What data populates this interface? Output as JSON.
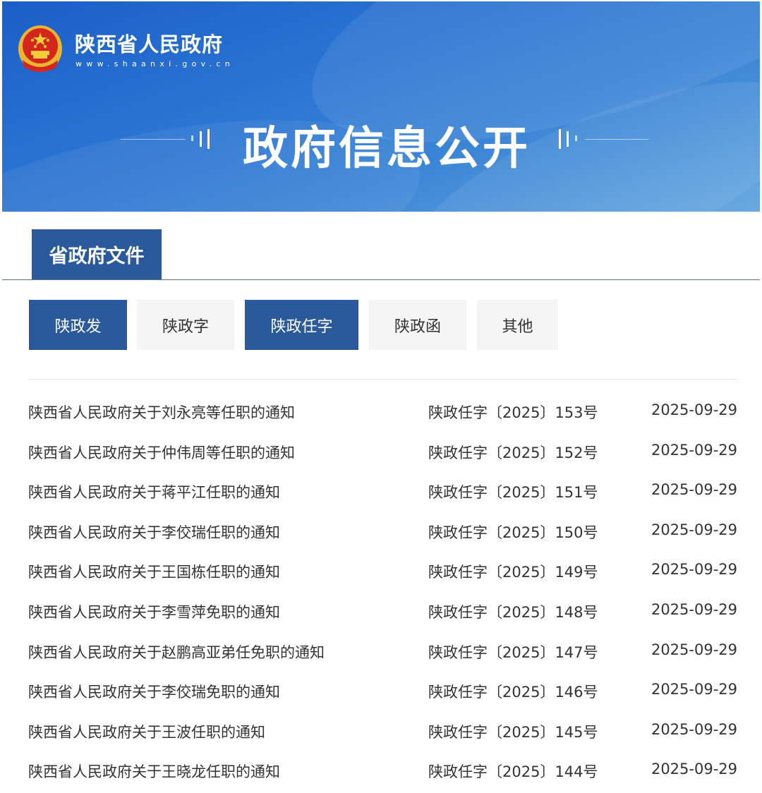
{
  "header": {
    "site_name": "陕西省人民政府",
    "site_url": "www.shaanxi.gov.cn",
    "banner_title": "政府信息公开",
    "emblem_icon": "national-emblem-icon"
  },
  "section": {
    "tab_label": "省政府文件"
  },
  "filters": [
    {
      "label": "陕政发",
      "active": true
    },
    {
      "label": "陕政字",
      "active": false
    },
    {
      "label": "陕政任字",
      "active": true
    },
    {
      "label": "陕政函",
      "active": false
    },
    {
      "label": "其他",
      "active": false
    }
  ],
  "documents": [
    {
      "title": "陕西省人民政府关于刘永亮等任职的通知",
      "number": "陕政任字〔2025〕153号",
      "date": "2025-09-29"
    },
    {
      "title": "陕西省人民政府关于仲伟周等任职的通知",
      "number": "陕政任字〔2025〕152号",
      "date": "2025-09-29"
    },
    {
      "title": "陕西省人民政府关于蒋平江任职的通知",
      "number": "陕政任字〔2025〕151号",
      "date": "2025-09-29"
    },
    {
      "title": "陕西省人民政府关于李佼瑞任职的通知",
      "number": "陕政任字〔2025〕150号",
      "date": "2025-09-29"
    },
    {
      "title": "陕西省人民政府关于王国栋任职的通知",
      "number": "陕政任字〔2025〕149号",
      "date": "2025-09-29"
    },
    {
      "title": "陕西省人民政府关于李雪萍免职的通知",
      "number": "陕政任字〔2025〕148号",
      "date": "2025-09-29"
    },
    {
      "title": "陕西省人民政府关于赵鹏高亚弟任免职的通知",
      "number": "陕政任字〔2025〕147号",
      "date": "2025-09-29"
    },
    {
      "title": "陕西省人民政府关于李佼瑞免职的通知",
      "number": "陕政任字〔2025〕146号",
      "date": "2025-09-29"
    },
    {
      "title": "陕西省人民政府关于王波任职的通知",
      "number": "陕政任字〔2025〕145号",
      "date": "2025-09-29"
    },
    {
      "title": "陕西省人民政府关于王晓龙任职的通知",
      "number": "陕政任字〔2025〕144号",
      "date": "2025-09-29"
    }
  ],
  "colors": {
    "accent": "#2a5a9c",
    "banner_blue": "#2a72d2",
    "chip_inactive_bg": "#f5f5f5",
    "text": "#333333"
  }
}
